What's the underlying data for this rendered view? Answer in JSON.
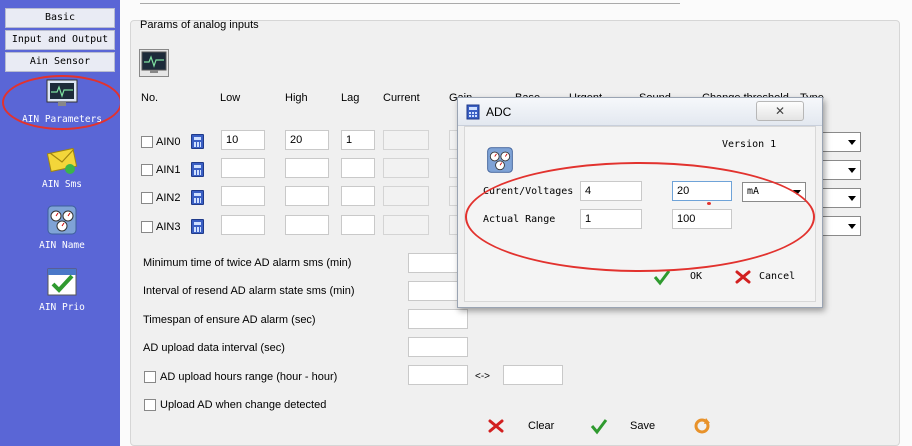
{
  "sidebar": {
    "tabs": [
      "Basic",
      "Input and Output",
      "Ain Sensor"
    ],
    "items": [
      {
        "label": "AIN Parameters",
        "icon": "monitor-icon"
      },
      {
        "label": "AIN Sms",
        "icon": "envelope-icon"
      },
      {
        "label": "AIN Name",
        "icon": "gauges-icon"
      },
      {
        "label": "AIN Prio",
        "icon": "checkmark-window-icon"
      }
    ]
  },
  "main": {
    "group_title": "Params of analog inputs",
    "columns": [
      "No.",
      "Low",
      "High",
      "Lag",
      "Current",
      "Gain",
      "Base",
      "Urgent",
      "Sound",
      "Change threshold",
      "Type"
    ],
    "rows": [
      {
        "name": "AIN0",
        "low": "10",
        "high": "20",
        "lag": "1"
      },
      {
        "name": "AIN1",
        "low": "",
        "high": "",
        "lag": ""
      },
      {
        "name": "AIN2",
        "low": "",
        "high": "",
        "lag": ""
      },
      {
        "name": "AIN3",
        "low": "",
        "high": "",
        "lag": ""
      }
    ],
    "settings": [
      "Minimum time of twice AD alarm sms (min)",
      "Interval of resend AD alarm state sms (min)",
      "Timespan of ensure AD alarm (sec)",
      "AD upload data interval (sec)"
    ],
    "hours_range_label": "AD upload hours range (hour - hour)",
    "hours_sep": "<->",
    "upload_change_label": "Upload AD when change detected",
    "clear_label": "Clear",
    "save_label": "Save"
  },
  "dialog": {
    "title": "ADC",
    "close": "✕",
    "version": "Version 1",
    "current_label": "Curent/Voltages",
    "current_from": "4",
    "current_to": "20",
    "unit": "mA",
    "range_label": "Actual Range",
    "range_from": "1",
    "range_to": "100",
    "ok_label": "OK",
    "cancel_label": "Cancel"
  },
  "colors": {
    "sidebar": "#5a66d6",
    "annotation": "#e2322e",
    "ok_green": "#2f9a2f",
    "cancel_red": "#d22020"
  }
}
